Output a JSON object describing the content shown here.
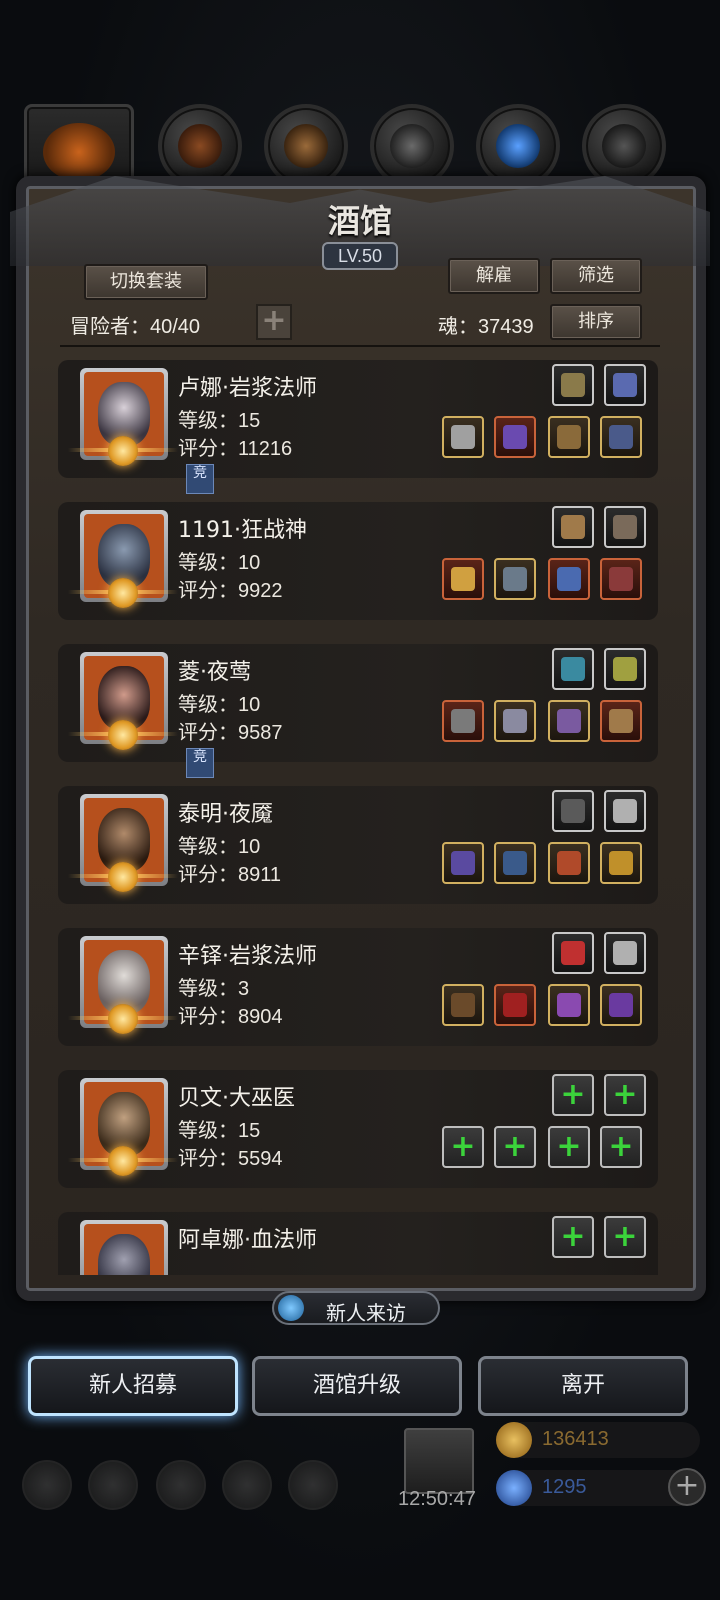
{
  "header": {
    "title": "酒馆",
    "level": "LV.50"
  },
  "toolbar": {
    "switch_outfit_label": "切换套装",
    "dismiss_label": "解雇",
    "filter_label": "筛选",
    "sort_label": "排序",
    "adventurer_label": "冒险者：40/40",
    "soul_label": "魂：37439"
  },
  "heroes": [
    {
      "name": "卢娜·岩浆法师",
      "level": "等级：15",
      "score": "评分：11216",
      "compete": "竞"
    },
    {
      "name": "1191·狂战神",
      "level": "等级：10",
      "score": "评分：9922"
    },
    {
      "name": "菱·夜莺",
      "level": "等级：10",
      "score": "评分：9587",
      "compete": "竞"
    },
    {
      "name": "泰明·夜魇",
      "level": "等级：10",
      "score": "评分：8911"
    },
    {
      "name": "辛铎·岩浆法师",
      "level": "等级：3",
      "score": "评分：8904"
    },
    {
      "name": "贝文·大巫医",
      "level": "等级：15",
      "score": "评分：5594"
    },
    {
      "name": "阿卓娜·血法师"
    }
  ],
  "visitor": {
    "label": "新人来访"
  },
  "actions": {
    "recruit": "新人招募",
    "upgrade": "酒馆升级",
    "leave": "离开"
  },
  "footer": {
    "clock": "12:50:47",
    "gold": "136413",
    "gems": "1295"
  },
  "colors": {
    "accent_gold": "#d1b060",
    "accent_blue": "#74b8ff",
    "panel_bg": "#2f2923"
  }
}
